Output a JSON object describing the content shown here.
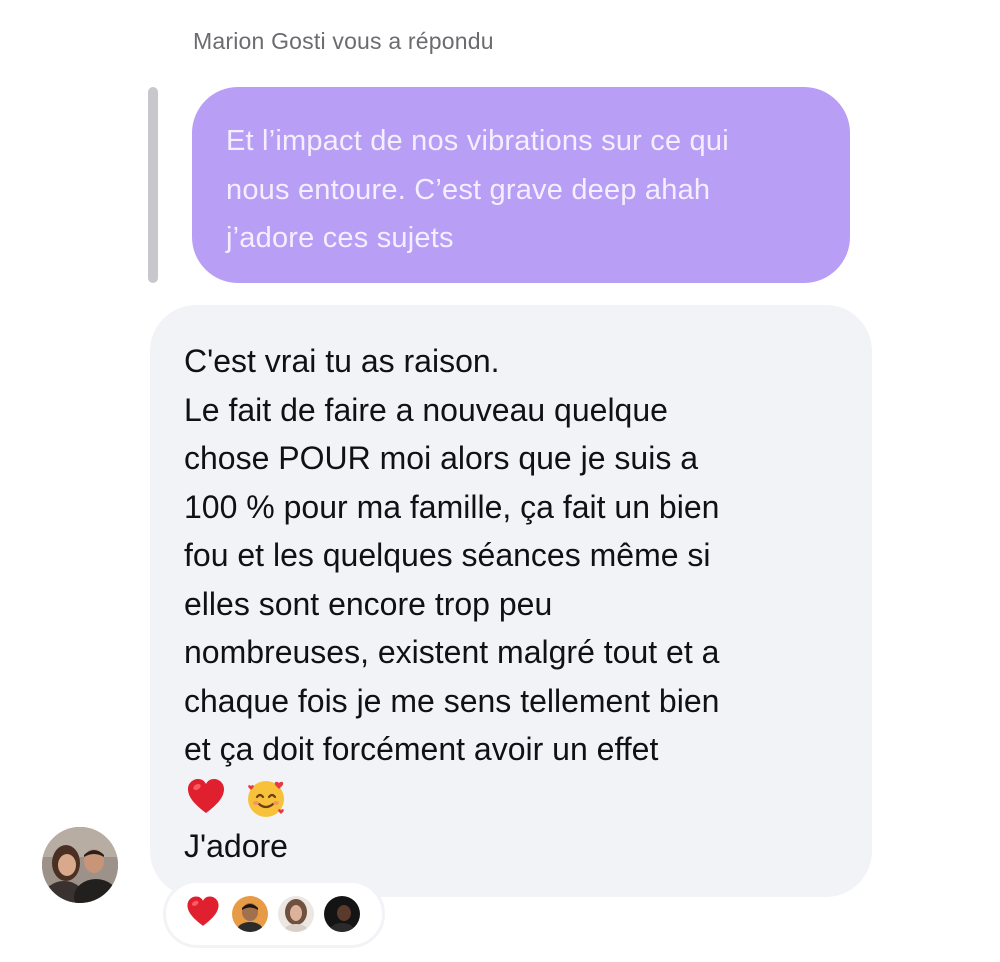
{
  "header": {
    "reply_label": "Marion Gosti vous a répondu"
  },
  "quoted_message": {
    "lines": [
      "Et l’impact de nos vibrations sur ce qui",
      "nous entoure. C’est grave deep ahah",
      "j’adore ces sujets"
    ],
    "bubble_color": "#b89ef5"
  },
  "message": {
    "lines": [
      "C'est vrai tu as raison.",
      "Le fait de faire a nouveau quelque",
      "chose POUR moi alors que je suis a",
      "100 % pour ma famille, ça fait un bien",
      "fou et les quelques séances même si",
      "elles sont encore trop peu",
      "nombreuses, existent malgré tout et a",
      "chaque fois je me sens tellement bien",
      "et ça doit forcément avoir un effet"
    ],
    "emojis": [
      "heart-emoji",
      "smiling-face-with-hearts-emoji"
    ],
    "closing": "J'adore",
    "bubble_color": "#f2f3f6"
  },
  "sender": {
    "avatar": "couple-photo-avatar"
  },
  "reactions": {
    "emoji": "heart-emoji",
    "reactor_avatars": [
      "man-avatar",
      "woman-avatar",
      "dark-avatar"
    ]
  }
}
